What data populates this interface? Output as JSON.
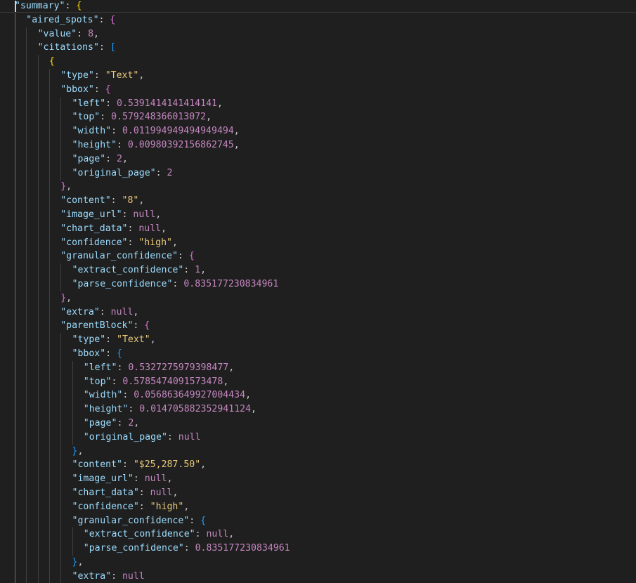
{
  "editor": {
    "theme": {
      "background": "#1f1f1f",
      "key_color": "#9cdcfe",
      "string_color": "#e8c87a",
      "number_color": "#c586c0",
      "punctuation_color": "#cccccc",
      "bracket_colors": [
        "#ffd700",
        "#da70d6",
        "#179fff"
      ]
    },
    "lines": [
      {
        "indent": 0,
        "tokens": [
          {
            "t": "\"summary\"",
            "c": "key"
          },
          {
            "t": ": ",
            "c": "p"
          },
          {
            "t": "{",
            "c": "b1"
          }
        ]
      },
      {
        "indent": 1,
        "tokens": [
          {
            "t": "\"aired_spots\"",
            "c": "key"
          },
          {
            "t": ": ",
            "c": "p"
          },
          {
            "t": "{",
            "c": "b2"
          }
        ]
      },
      {
        "indent": 2,
        "tokens": [
          {
            "t": "\"value\"",
            "c": "key"
          },
          {
            "t": ": ",
            "c": "p"
          },
          {
            "t": "8",
            "c": "numv"
          },
          {
            "t": ",",
            "c": "p"
          }
        ]
      },
      {
        "indent": 2,
        "tokens": [
          {
            "t": "\"citations\"",
            "c": "key"
          },
          {
            "t": ": ",
            "c": "p"
          },
          {
            "t": "[",
            "c": "b3"
          }
        ]
      },
      {
        "indent": 3,
        "tokens": [
          {
            "t": "{",
            "c": "b1"
          }
        ]
      },
      {
        "indent": 4,
        "tokens": [
          {
            "t": "\"type\"",
            "c": "key"
          },
          {
            "t": ": ",
            "c": "p"
          },
          {
            "t": "\"Text\"",
            "c": "strv"
          },
          {
            "t": ",",
            "c": "p"
          }
        ]
      },
      {
        "indent": 4,
        "tokens": [
          {
            "t": "\"bbox\"",
            "c": "key"
          },
          {
            "t": ": ",
            "c": "p"
          },
          {
            "t": "{",
            "c": "b2"
          }
        ]
      },
      {
        "indent": 5,
        "tokens": [
          {
            "t": "\"left\"",
            "c": "key"
          },
          {
            "t": ": ",
            "c": "p"
          },
          {
            "t": "0.5391414141414141",
            "c": "numv"
          },
          {
            "t": ",",
            "c": "p"
          }
        ]
      },
      {
        "indent": 5,
        "tokens": [
          {
            "t": "\"top\"",
            "c": "key"
          },
          {
            "t": ": ",
            "c": "p"
          },
          {
            "t": "0.579248366013072",
            "c": "numv"
          },
          {
            "t": ",",
            "c": "p"
          }
        ]
      },
      {
        "indent": 5,
        "tokens": [
          {
            "t": "\"width\"",
            "c": "key"
          },
          {
            "t": ": ",
            "c": "p"
          },
          {
            "t": "0.011994949494949494",
            "c": "numv"
          },
          {
            "t": ",",
            "c": "p"
          }
        ]
      },
      {
        "indent": 5,
        "tokens": [
          {
            "t": "\"height\"",
            "c": "key"
          },
          {
            "t": ": ",
            "c": "p"
          },
          {
            "t": "0.00980392156862745",
            "c": "numv"
          },
          {
            "t": ",",
            "c": "p"
          }
        ]
      },
      {
        "indent": 5,
        "tokens": [
          {
            "t": "\"page\"",
            "c": "key"
          },
          {
            "t": ": ",
            "c": "p"
          },
          {
            "t": "2",
            "c": "numv"
          },
          {
            "t": ",",
            "c": "p"
          }
        ]
      },
      {
        "indent": 5,
        "tokens": [
          {
            "t": "\"original_page\"",
            "c": "key"
          },
          {
            "t": ": ",
            "c": "p"
          },
          {
            "t": "2",
            "c": "numv"
          }
        ]
      },
      {
        "indent": 4,
        "tokens": [
          {
            "t": "}",
            "c": "b2"
          },
          {
            "t": ",",
            "c": "p"
          }
        ]
      },
      {
        "indent": 4,
        "tokens": [
          {
            "t": "\"content\"",
            "c": "key"
          },
          {
            "t": ": ",
            "c": "p"
          },
          {
            "t": "\"8\"",
            "c": "strv"
          },
          {
            "t": ",",
            "c": "p"
          }
        ]
      },
      {
        "indent": 4,
        "tokens": [
          {
            "t": "\"image_url\"",
            "c": "key"
          },
          {
            "t": ": ",
            "c": "p"
          },
          {
            "t": "null",
            "c": "numv"
          },
          {
            "t": ",",
            "c": "p"
          }
        ]
      },
      {
        "indent": 4,
        "tokens": [
          {
            "t": "\"chart_data\"",
            "c": "key"
          },
          {
            "t": ": ",
            "c": "p"
          },
          {
            "t": "null",
            "c": "numv"
          },
          {
            "t": ",",
            "c": "p"
          }
        ]
      },
      {
        "indent": 4,
        "tokens": [
          {
            "t": "\"confidence\"",
            "c": "key"
          },
          {
            "t": ": ",
            "c": "p"
          },
          {
            "t": "\"high\"",
            "c": "strv"
          },
          {
            "t": ",",
            "c": "p"
          }
        ]
      },
      {
        "indent": 4,
        "tokens": [
          {
            "t": "\"granular_confidence\"",
            "c": "key"
          },
          {
            "t": ": ",
            "c": "p"
          },
          {
            "t": "{",
            "c": "b2"
          }
        ]
      },
      {
        "indent": 5,
        "tokens": [
          {
            "t": "\"extract_confidence\"",
            "c": "key"
          },
          {
            "t": ": ",
            "c": "p"
          },
          {
            "t": "1",
            "c": "numv"
          },
          {
            "t": ",",
            "c": "p"
          }
        ]
      },
      {
        "indent": 5,
        "tokens": [
          {
            "t": "\"parse_confidence\"",
            "c": "key"
          },
          {
            "t": ": ",
            "c": "p"
          },
          {
            "t": "0.835177230834961",
            "c": "numv"
          }
        ]
      },
      {
        "indent": 4,
        "tokens": [
          {
            "t": "}",
            "c": "b2"
          },
          {
            "t": ",",
            "c": "p"
          }
        ]
      },
      {
        "indent": 4,
        "tokens": [
          {
            "t": "\"extra\"",
            "c": "key"
          },
          {
            "t": ": ",
            "c": "p"
          },
          {
            "t": "null",
            "c": "numv"
          },
          {
            "t": ",",
            "c": "p"
          }
        ]
      },
      {
        "indent": 4,
        "tokens": [
          {
            "t": "\"parentBlock\"",
            "c": "key"
          },
          {
            "t": ": ",
            "c": "p"
          },
          {
            "t": "{",
            "c": "b2"
          }
        ]
      },
      {
        "indent": 5,
        "tokens": [
          {
            "t": "\"type\"",
            "c": "key"
          },
          {
            "t": ": ",
            "c": "p"
          },
          {
            "t": "\"Text\"",
            "c": "strv"
          },
          {
            "t": ",",
            "c": "p"
          }
        ]
      },
      {
        "indent": 5,
        "tokens": [
          {
            "t": "\"bbox\"",
            "c": "key"
          },
          {
            "t": ": ",
            "c": "p"
          },
          {
            "t": "{",
            "c": "b3"
          }
        ]
      },
      {
        "indent": 6,
        "tokens": [
          {
            "t": "\"left\"",
            "c": "key"
          },
          {
            "t": ": ",
            "c": "p"
          },
          {
            "t": "0.5327275979398477",
            "c": "numv"
          },
          {
            "t": ",",
            "c": "p"
          }
        ]
      },
      {
        "indent": 6,
        "tokens": [
          {
            "t": "\"top\"",
            "c": "key"
          },
          {
            "t": ": ",
            "c": "p"
          },
          {
            "t": "0.5785474091573478",
            "c": "numv"
          },
          {
            "t": ",",
            "c": "p"
          }
        ]
      },
      {
        "indent": 6,
        "tokens": [
          {
            "t": "\"width\"",
            "c": "key"
          },
          {
            "t": ": ",
            "c": "p"
          },
          {
            "t": "0.056863649927004434",
            "c": "numv"
          },
          {
            "t": ",",
            "c": "p"
          }
        ]
      },
      {
        "indent": 6,
        "tokens": [
          {
            "t": "\"height\"",
            "c": "key"
          },
          {
            "t": ": ",
            "c": "p"
          },
          {
            "t": "0.014705882352941124",
            "c": "numv"
          },
          {
            "t": ",",
            "c": "p"
          }
        ]
      },
      {
        "indent": 6,
        "tokens": [
          {
            "t": "\"page\"",
            "c": "key"
          },
          {
            "t": ": ",
            "c": "p"
          },
          {
            "t": "2",
            "c": "numv"
          },
          {
            "t": ",",
            "c": "p"
          }
        ]
      },
      {
        "indent": 6,
        "tokens": [
          {
            "t": "\"original_page\"",
            "c": "key"
          },
          {
            "t": ": ",
            "c": "p"
          },
          {
            "t": "null",
            "c": "numv"
          }
        ]
      },
      {
        "indent": 5,
        "tokens": [
          {
            "t": "}",
            "c": "b3"
          },
          {
            "t": ",",
            "c": "p"
          }
        ]
      },
      {
        "indent": 5,
        "tokens": [
          {
            "t": "\"content\"",
            "c": "key"
          },
          {
            "t": ": ",
            "c": "p"
          },
          {
            "t": "\"$25,287.50\"",
            "c": "strv"
          },
          {
            "t": ",",
            "c": "p"
          }
        ]
      },
      {
        "indent": 5,
        "tokens": [
          {
            "t": "\"image_url\"",
            "c": "key"
          },
          {
            "t": ": ",
            "c": "p"
          },
          {
            "t": "null",
            "c": "numv"
          },
          {
            "t": ",",
            "c": "p"
          }
        ]
      },
      {
        "indent": 5,
        "tokens": [
          {
            "t": "\"chart_data\"",
            "c": "key"
          },
          {
            "t": ": ",
            "c": "p"
          },
          {
            "t": "null",
            "c": "numv"
          },
          {
            "t": ",",
            "c": "p"
          }
        ]
      },
      {
        "indent": 5,
        "tokens": [
          {
            "t": "\"confidence\"",
            "c": "key"
          },
          {
            "t": ": ",
            "c": "p"
          },
          {
            "t": "\"high\"",
            "c": "strv"
          },
          {
            "t": ",",
            "c": "p"
          }
        ]
      },
      {
        "indent": 5,
        "tokens": [
          {
            "t": "\"granular_confidence\"",
            "c": "key"
          },
          {
            "t": ": ",
            "c": "p"
          },
          {
            "t": "{",
            "c": "b3"
          }
        ]
      },
      {
        "indent": 6,
        "tokens": [
          {
            "t": "\"extract_confidence\"",
            "c": "key"
          },
          {
            "t": ": ",
            "c": "p"
          },
          {
            "t": "null",
            "c": "numv"
          },
          {
            "t": ",",
            "c": "p"
          }
        ]
      },
      {
        "indent": 6,
        "tokens": [
          {
            "t": "\"parse_confidence\"",
            "c": "key"
          },
          {
            "t": ": ",
            "c": "p"
          },
          {
            "t": "0.835177230834961",
            "c": "numv"
          }
        ]
      },
      {
        "indent": 5,
        "tokens": [
          {
            "t": "}",
            "c": "b3"
          },
          {
            "t": ",",
            "c": "p"
          }
        ]
      },
      {
        "indent": 5,
        "tokens": [
          {
            "t": "\"extra\"",
            "c": "key"
          },
          {
            "t": ": ",
            "c": "p"
          },
          {
            "t": "null",
            "c": "numv"
          }
        ]
      }
    ]
  }
}
